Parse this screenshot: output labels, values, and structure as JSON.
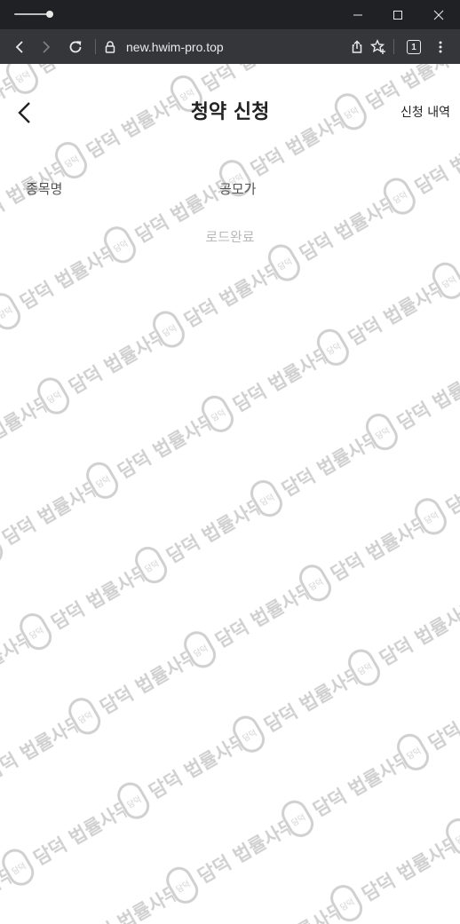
{
  "browser": {
    "url": "new.hwim-pro.top",
    "tab_count": "1",
    "colors": {
      "titlebar": "#202124",
      "toolbar": "#35363a",
      "url_text": "#e8eaed"
    }
  },
  "page": {
    "title": "청약 신청",
    "history_link": "신청 내역",
    "columns": {
      "name": "종목명",
      "price": "공모가"
    },
    "load_status": "로드완료",
    "watermark_text": "담덕 법률사무소",
    "watermark_seal": "담덕",
    "colors": {
      "title": "#222222",
      "column_header": "#555555",
      "load_status": "#b9b9b9",
      "watermark": "#d0d0d0"
    }
  }
}
